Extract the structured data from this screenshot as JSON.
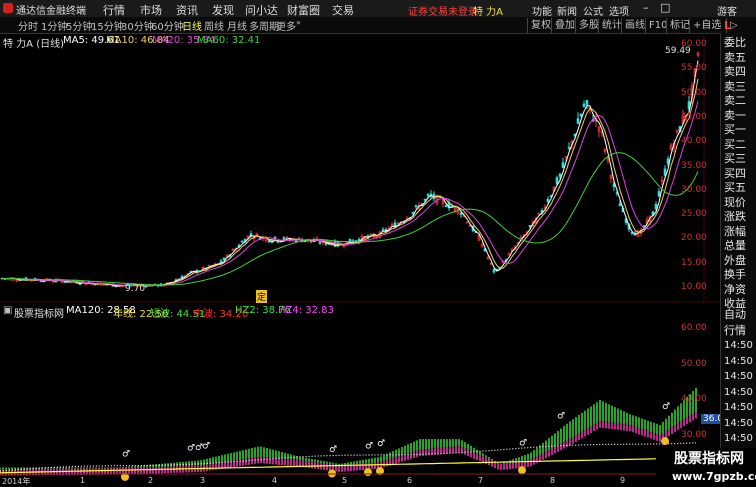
{
  "menu": {
    "app_title": "通达信金融终端",
    "items": [
      "行情",
      "市场",
      "资讯",
      "发现",
      "问小达",
      "财富圈",
      "交易"
    ],
    "login_notice": "证券交易未登录",
    "stock_name": "特 力A",
    "right_items": [
      "功能",
      "新闻",
      "公式",
      "选项",
      "游客"
    ]
  },
  "periods": {
    "items": [
      "分时",
      "1分钟",
      "5分钟",
      "15分钟",
      "30分钟",
      "60分钟",
      "日线",
      "周线",
      "月线",
      "多周期",
      "更多"
    ],
    "active": "日线"
  },
  "toolbar": {
    "buttons": [
      "复权",
      "叠加",
      "多股",
      "统计",
      "画线",
      "F10",
      "标记"
    ],
    "zixuan": "+自选"
  },
  "main_chart": {
    "title": "特 力A (日线)",
    "ma": [
      {
        "label": "MA5: 49.61",
        "color": "#ffffff"
      },
      {
        "label": "MA10: 46.84",
        "color": "#f0d060"
      },
      {
        "label": "MA20: 35.84",
        "color": "#e040e0"
      },
      {
        "label": "MA60: 32.41",
        "color": "#40d040"
      }
    ],
    "y_ticks": [
      "60.00",
      "55.00",
      "50.00",
      "45.00",
      "40.00",
      "35.00",
      "30.00",
      "25.00",
      "20.00",
      "15.00",
      "10.00"
    ],
    "high_label": "59.49",
    "low_label": "9.70",
    "ding_label": "定"
  },
  "indicator": {
    "name": "股票指标网",
    "values": [
      {
        "label": "MA120: 28.58",
        "color": "#ffffff"
      },
      {
        "label": "年线: 22.50",
        "color": "#f0e040"
      },
      {
        "label": "短波: 44.51",
        "color": "#40e040"
      },
      {
        "label": "中波: 34.20",
        "color": "#ff3030"
      },
      {
        "label": "HZ2: 38.76",
        "color": "#40e040"
      },
      {
        "label": "HZ4: 32.83",
        "color": "#ff40ff"
      }
    ],
    "y_ticks": [
      "60.00",
      "50.00",
      "40.00",
      "30.00",
      "20.00"
    ],
    "price_tag": "36.01"
  },
  "x_axis": [
    "2014年",
    "1",
    "2",
    "3",
    "4",
    "5",
    "6",
    "7",
    "8",
    "9",
    "10"
  ],
  "side_panel": {
    "labels": [
      "委比",
      "卖五",
      "卖四",
      "卖三",
      "卖二",
      "卖一",
      "买一",
      "买二",
      "买三",
      "买四",
      "买五",
      "现价",
      "涨跌",
      "涨幅",
      "总量",
      "外盘",
      "换手",
      "净资",
      "收益"
    ],
    "lower_labels": [
      "自动",
      "行情",
      "14:50",
      "14:50",
      "14:50",
      "14:50",
      "14:50",
      "14:50",
      "14:50",
      "14:50"
    ],
    "top_icons": "L"
  },
  "watermark": {
    "line1": "股票指标网",
    "line2": "www.7gpzb.com"
  },
  "colors": {
    "up": "#ff3030",
    "down": "#30e0e0",
    "ma5": "#ffffff",
    "ma10": "#f0d060",
    "ma20": "#e040e0",
    "ma60": "#40d040",
    "green_band": "#30e030",
    "magenta_band": "#ff30c0",
    "yellow_line": "#ffff30"
  }
}
